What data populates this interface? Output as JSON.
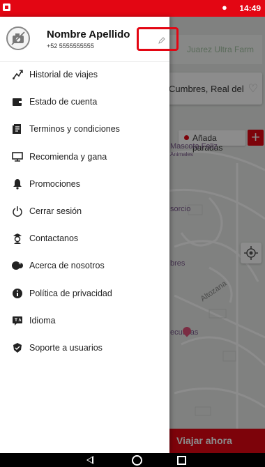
{
  "status_bar": {
    "time": "14:49"
  },
  "background": {
    "address_text": "Cumbres, Real del",
    "top_address_text": "Juarez Ultra Farm",
    "stops_label": "Añada paradas",
    "plus_label": "+",
    "map_labels": [
      "Mascota Feliz",
      "Animales",
      "sorcio",
      "bres",
      "Altozana",
      "ecutivas"
    ],
    "button_label": "Viajar ahora"
  },
  "colors": {
    "brand": "#e30613"
  },
  "drawer": {
    "profile": {
      "name": "Nombre Apellido",
      "phone": "+52 5555555555"
    },
    "menu_items": [
      {
        "label": "Historial de viajes",
        "icon": "route-icon"
      },
      {
        "label": "Estado de cuenta",
        "icon": "wallet-icon"
      },
      {
        "label": "Terminos y condiciones",
        "icon": "document-icon"
      },
      {
        "label": "Recomienda y gana",
        "icon": "monitor-icon"
      },
      {
        "label": "Promociones",
        "icon": "bell-icon"
      },
      {
        "label": "Cerrar sesión",
        "icon": "power-icon"
      },
      {
        "label": "Contactanos",
        "icon": "agent-icon"
      },
      {
        "label": "Acerca de nosotros",
        "icon": "team-icon"
      },
      {
        "label": "Política de privacidad",
        "icon": "info-icon"
      },
      {
        "label": "Idioma",
        "icon": "translate-icon"
      },
      {
        "label": "Soporte a usuarios",
        "icon": "support-icon"
      }
    ]
  }
}
